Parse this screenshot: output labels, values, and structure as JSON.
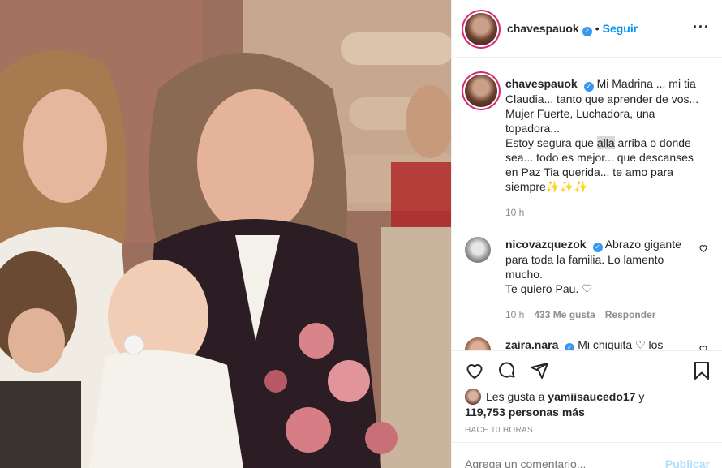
{
  "post": {
    "username": "chavespauok",
    "follow_label": "Seguir",
    "dot": "•",
    "more_label": "···"
  },
  "caption": {
    "username": "chavespauok",
    "text_1": "Mi Madrina ... mi tia Claudia... tanto que aprender de vos... Mujer Fuerte, Luchadora, una topadora...",
    "text_2a": "Estoy segura que ",
    "text_2_highlight": "alla",
    "text_2b": " arriba o donde sea... todo es mejor... que descanses en Paz Tia querida... te amo para siempre",
    "sparkles": "✨✨✨",
    "time": "10 h"
  },
  "comments": [
    {
      "username": "nicovazquezok",
      "text_1": "Abrazo gigante para toda la familia. Lo lamento mucho.",
      "text_2": "Te quiero Pau.",
      "time": "10 h",
      "likes": "433 Me gusta",
      "reply": "Responder"
    },
    {
      "username": "zaira.nara",
      "text": "Mi chiquita ♡ los"
    }
  ],
  "likes": {
    "prefix": "Les gusta a ",
    "user": "yamiisaucedo17",
    "and": " y",
    "count": "119,753 personas más"
  },
  "timestamp": "HACE 10 HORAS",
  "add_comment": {
    "placeholder": "Agrega un comentario...",
    "publish": "Publicar"
  },
  "colors": {
    "accent": "#0095f6",
    "verified": "#3897f0",
    "muted": "#8e8e8e",
    "publish_disabled": "#b2dffc"
  },
  "icons": [
    "heart-icon",
    "comment-icon",
    "share-icon",
    "bookmark-icon",
    "verified-icon",
    "more-options-icon"
  ]
}
